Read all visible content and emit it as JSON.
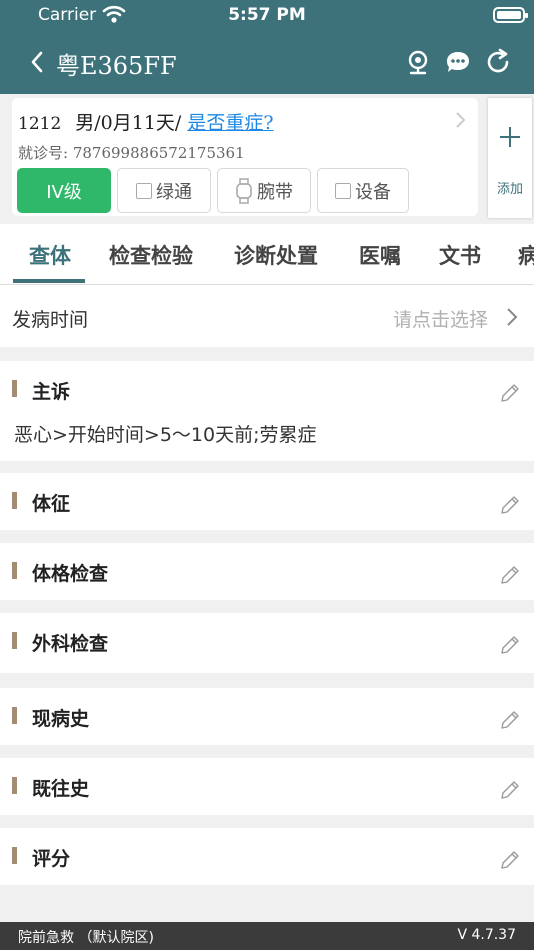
{
  "status_bar": {
    "carrier": "Carrier",
    "time": "5:57 PM"
  },
  "nav": {
    "title": "粤E365FF"
  },
  "patient": {
    "id": "1212",
    "demographics": "男/0月11天/",
    "severity_link": "是否重症?",
    "visit_label": "就诊号:",
    "visit_number": "787699886572175361"
  },
  "chips": {
    "level": "IV级",
    "green_channel": "绿通",
    "wristband": "腕带",
    "device": "设备"
  },
  "add_button": {
    "label": "添加"
  },
  "tabs": [
    "查体",
    "检查检验",
    "诊断处置",
    "医嘱",
    "文书",
    "病"
  ],
  "onset": {
    "label": "发病时间",
    "placeholder": "请点击选择"
  },
  "sections": [
    {
      "title": "主诉",
      "content": "恶心>开始时间>5～10天前;劳累症"
    },
    {
      "title": "体征"
    },
    {
      "title": "体格检查"
    },
    {
      "title": "外科检查"
    },
    {
      "title": "现病史"
    },
    {
      "title": "既往史"
    },
    {
      "title": "评分"
    }
  ],
  "footer": {
    "left": "院前急救 （默认院区)",
    "version": "V 4.7.37"
  },
  "colors": {
    "header": "#3e727b",
    "level_green": "#2fb86a",
    "link_blue": "#1e88e5",
    "section_bar": "#a48c72",
    "footer": "#3b3b3b"
  }
}
